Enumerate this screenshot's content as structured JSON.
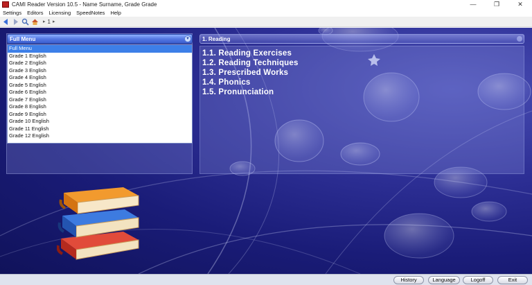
{
  "window": {
    "title": "CAMI Reader Version 10.5 - Name Surname, Grade Grade",
    "controls": {
      "minimize": "—",
      "maximize": "❐",
      "close": "✕"
    }
  },
  "menubar": {
    "items": [
      {
        "label": "Settings"
      },
      {
        "label": "Editors"
      },
      {
        "label": "Licensing"
      },
      {
        "label": "SpeedNotes"
      },
      {
        "label": "Help"
      }
    ]
  },
  "toolbar": {
    "icons": [
      "back-arrow-icon",
      "forward-arrow-icon",
      "search-icon",
      "home-icon"
    ],
    "breadcrumb_sep1": "▸",
    "breadcrumb_page": "1",
    "breadcrumb_sep2": "▸"
  },
  "left": {
    "dropdown_selected": "Full Menu",
    "options": [
      "Full Menu",
      "Grade 1 English",
      "Grade 2 English",
      "Grade 3 English",
      "Grade 4 English",
      "Grade 5 English",
      "Grade 6 English",
      "Grade 7 English",
      "Grade 8 English",
      "Grade 9 English",
      "Grade 10 English",
      "Grade 11 English",
      "Grade 12 English"
    ]
  },
  "right": {
    "header": "1. Reading",
    "topics": [
      "1.1. Reading Exercises",
      "1.2. Reading Techniques",
      "1.3. Prescribed Works",
      "1.4. Phonics",
      "1.5. Pronunciation"
    ]
  },
  "bottom": {
    "history": "History",
    "language": "Language",
    "logoff": "Logoff",
    "exit": "Exit"
  },
  "colors": {
    "background_deep": "#10125a",
    "background_mid": "#2d2f95",
    "dropdown_selected": "#3d7fe8",
    "panel_text": "#ffffff"
  }
}
